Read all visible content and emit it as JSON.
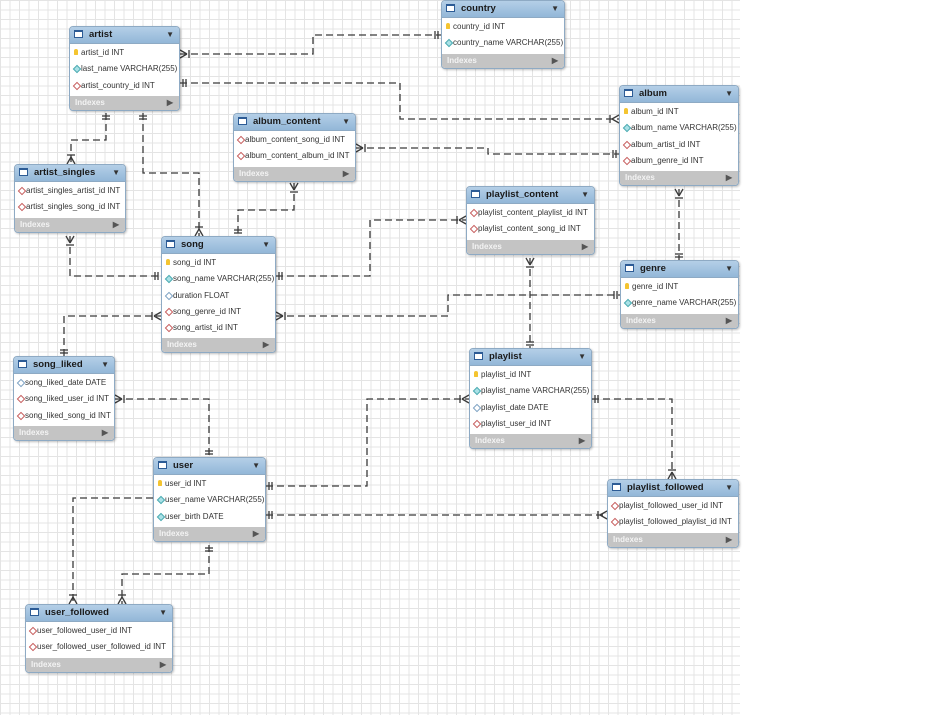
{
  "footer_label": "Indexes",
  "tables": {
    "country": {
      "name": "country",
      "cols": [
        {
          "text": "country_id INT",
          "kind": "pk"
        },
        {
          "text": "country_name VARCHAR(255)",
          "kind": "nn"
        }
      ]
    },
    "artist": {
      "name": "artist",
      "cols": [
        {
          "text": "artist_id INT",
          "kind": "pk"
        },
        {
          "text": "last_name VARCHAR(255)",
          "kind": "nn"
        },
        {
          "text": "artist_country_id INT",
          "kind": "fk"
        }
      ]
    },
    "album": {
      "name": "album",
      "cols": [
        {
          "text": "album_id INT",
          "kind": "pk"
        },
        {
          "text": "album_name VARCHAR(255)",
          "kind": "nn"
        },
        {
          "text": "album_artist_id INT",
          "kind": "fk"
        },
        {
          "text": "album_genre_id INT",
          "kind": "fk"
        }
      ]
    },
    "album_content": {
      "name": "album_content",
      "cols": [
        {
          "text": "album_content_song_id INT",
          "kind": "fk"
        },
        {
          "text": "album_content_album_id INT",
          "kind": "fk"
        }
      ]
    },
    "artist_singles": {
      "name": "artist_singles",
      "cols": [
        {
          "text": "artist_singles_artist_id INT",
          "kind": "fk"
        },
        {
          "text": "artist_singles_song_id INT",
          "kind": "fk"
        }
      ]
    },
    "playlist_content": {
      "name": "playlist_content",
      "cols": [
        {
          "text": "playlist_content_playlist_id INT",
          "kind": "fk"
        },
        {
          "text": "playlist_content_song_id INT",
          "kind": "fk"
        }
      ]
    },
    "song": {
      "name": "song",
      "cols": [
        {
          "text": "song_id INT",
          "kind": "pk"
        },
        {
          "text": "song_name VARCHAR(255)",
          "kind": "nn"
        },
        {
          "text": "duration FLOAT",
          "kind": "plain"
        },
        {
          "text": "song_genre_id INT",
          "kind": "fk"
        },
        {
          "text": "song_artist_id INT",
          "kind": "fk"
        }
      ]
    },
    "genre": {
      "name": "genre",
      "cols": [
        {
          "text": "genre_id INT",
          "kind": "pk"
        },
        {
          "text": "genre_name VARCHAR(255)",
          "kind": "nn"
        }
      ]
    },
    "song_liked": {
      "name": "song_liked",
      "cols": [
        {
          "text": "song_liked_date DATE",
          "kind": "plain"
        },
        {
          "text": "song_liked_user_id INT",
          "kind": "fk"
        },
        {
          "text": "song_liked_song_id INT",
          "kind": "fk"
        }
      ]
    },
    "playlist": {
      "name": "playlist",
      "cols": [
        {
          "text": "playlist_id INT",
          "kind": "pk"
        },
        {
          "text": "playlist_name VARCHAR(255)",
          "kind": "nn"
        },
        {
          "text": "playlist_date DATE",
          "kind": "plain"
        },
        {
          "text": "playlist_user_id INT",
          "kind": "fk"
        }
      ]
    },
    "user": {
      "name": "user",
      "cols": [
        {
          "text": "user_id INT",
          "kind": "pk"
        },
        {
          "text": "user_name VARCHAR(255)",
          "kind": "nn"
        },
        {
          "text": "user_birth DATE",
          "kind": "nn"
        }
      ]
    },
    "playlist_followed": {
      "name": "playlist_followed",
      "cols": [
        {
          "text": "playlist_followed_user_id INT",
          "kind": "fk"
        },
        {
          "text": "playlist_followed_playlist_id INT",
          "kind": "fk"
        }
      ]
    },
    "user_followed": {
      "name": "user_followed",
      "cols": [
        {
          "text": "user_followed_user_id INT",
          "kind": "fk"
        },
        {
          "text": "user_followed_user_followed_id INT",
          "kind": "fk"
        }
      ]
    }
  },
  "colors": {
    "header": "#a6c6e2",
    "primary_key": "#f4c430",
    "foreign_key": "#c65b5b",
    "not_null": "#4aa9b0",
    "footer": "#c4c4c4"
  },
  "icons": {
    "table": "table-icon",
    "expand": "chevron-down-icon",
    "indexes": "chevron-right-icon"
  }
}
